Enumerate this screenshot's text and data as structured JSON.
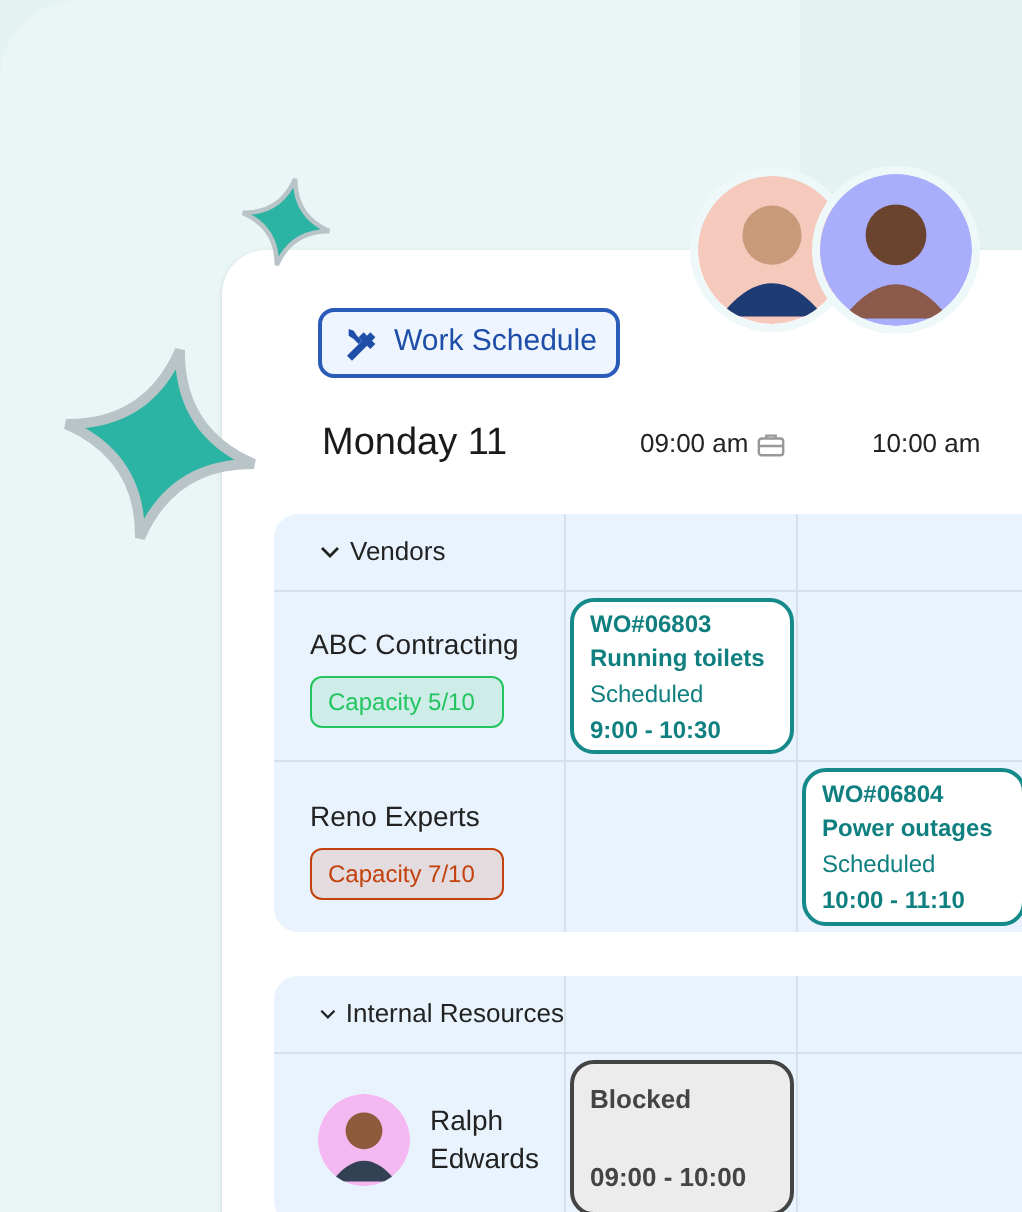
{
  "header_button": {
    "label": "Work Schedule"
  },
  "day": "Monday 11",
  "time_slots": [
    {
      "kind": "with_icon",
      "label": "09:00 am"
    },
    {
      "kind": "plain",
      "label": "10:00 am"
    }
  ],
  "groups": [
    {
      "label": "Vendors",
      "expanded": true,
      "rows": [
        {
          "kind": "vendor",
          "name": "ABC Contracting",
          "capacity": {
            "label": "Capacity 5/10",
            "color": "#22c55e"
          },
          "cells": [
            {
              "kind": "work_order",
              "id": "WO#06803",
              "title": "Running toilets",
              "status": "Scheduled",
              "time": "9:00 - 10:30"
            },
            {
              "kind": "empty"
            },
            {
              "kind": "empty"
            }
          ]
        },
        {
          "kind": "vendor",
          "name": "Reno Experts",
          "capacity": {
            "label": "Capacity 7/10",
            "color": "#c2410c"
          },
          "cells": [
            {
              "kind": "empty"
            },
            {
              "kind": "work_order",
              "id": "WO#06804",
              "title": "Power outages",
              "status": "Scheduled",
              "time": "10:00 - 11:10"
            },
            {
              "kind": "empty"
            }
          ]
        }
      ]
    },
    {
      "label": "Internal Resources",
      "expanded": true,
      "rows": [
        {
          "kind": "person",
          "name": "Ralph Edwards",
          "cells": [
            {
              "kind": "blocked",
              "title": "Blocked",
              "time": "09:00 - 10:00"
            },
            {
              "kind": "empty"
            },
            {
              "kind": "empty"
            }
          ]
        }
      ]
    }
  ]
}
